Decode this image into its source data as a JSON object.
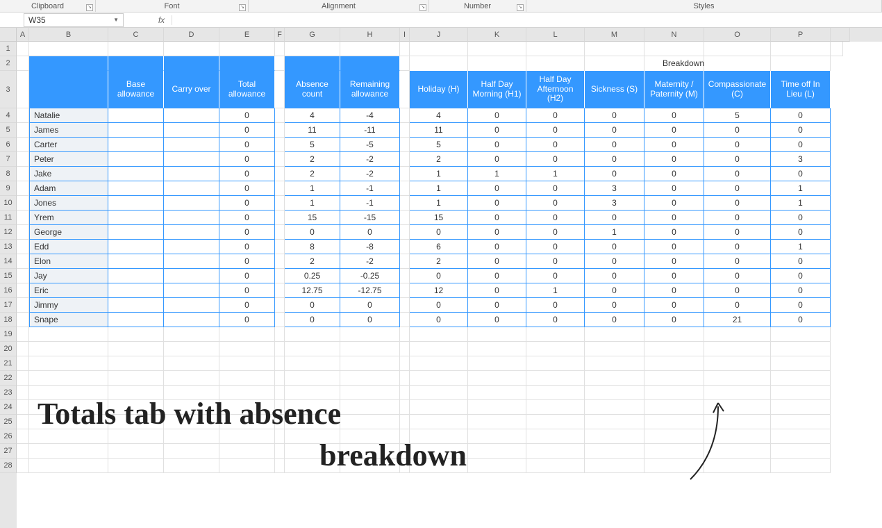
{
  "ribbon": {
    "groups": [
      "Clipboard",
      "Font",
      "Alignment",
      "Number",
      "Styles"
    ]
  },
  "cell_ref": "W35",
  "fx_label": "fx",
  "formula_value": "",
  "columns": [
    "A",
    "B",
    "C",
    "D",
    "E",
    "F",
    "G",
    "H",
    "I",
    "J",
    "K",
    "L",
    "M",
    "N",
    "O",
    "P"
  ],
  "row_numbers": [
    1,
    2,
    3,
    4,
    5,
    6,
    7,
    8,
    9,
    10,
    11,
    12,
    13,
    14,
    15,
    16,
    17,
    18,
    19,
    20,
    21,
    22,
    23,
    24,
    25,
    26,
    27,
    28
  ],
  "breakdown_title": "Breakdown",
  "headers": {
    "name": "",
    "base": "Base allowance",
    "carry": "Carry over",
    "total": "Total allowance",
    "abs": "Absence count",
    "rem": "Remaining allowance",
    "j": "Holiday (H)",
    "k": "Half Day Morning (H1)",
    "l": "Half Day Afternoon (H2)",
    "m": "Sickness (S)",
    "n": "Maternity / Paternity (M)",
    "o": "Compassionate (C)",
    "p": "Time off In Lieu (L)"
  },
  "rows": [
    {
      "name": "Natalie",
      "total": "0",
      "abs": "4",
      "rem": "-4",
      "j": "4",
      "k": "0",
      "l": "0",
      "m": "0",
      "n": "0",
      "o": "5",
      "p": "0"
    },
    {
      "name": "James",
      "total": "0",
      "abs": "11",
      "rem": "-11",
      "j": "11",
      "k": "0",
      "l": "0",
      "m": "0",
      "n": "0",
      "o": "0",
      "p": "0"
    },
    {
      "name": "Carter",
      "total": "0",
      "abs": "5",
      "rem": "-5",
      "j": "5",
      "k": "0",
      "l": "0",
      "m": "0",
      "n": "0",
      "o": "0",
      "p": "0"
    },
    {
      "name": "Peter",
      "total": "0",
      "abs": "2",
      "rem": "-2",
      "j": "2",
      "k": "0",
      "l": "0",
      "m": "0",
      "n": "0",
      "o": "0",
      "p": "3"
    },
    {
      "name": "Jake",
      "total": "0",
      "abs": "2",
      "rem": "-2",
      "j": "1",
      "k": "1",
      "l": "1",
      "m": "0",
      "n": "0",
      "o": "0",
      "p": "0"
    },
    {
      "name": "Adam",
      "total": "0",
      "abs": "1",
      "rem": "-1",
      "j": "1",
      "k": "0",
      "l": "0",
      "m": "3",
      "n": "0",
      "o": "0",
      "p": "1"
    },
    {
      "name": "Jones",
      "total": "0",
      "abs": "1",
      "rem": "-1",
      "j": "1",
      "k": "0",
      "l": "0",
      "m": "3",
      "n": "0",
      "o": "0",
      "p": "1"
    },
    {
      "name": "Yrem",
      "total": "0",
      "abs": "15",
      "rem": "-15",
      "j": "15",
      "k": "0",
      "l": "0",
      "m": "0",
      "n": "0",
      "o": "0",
      "p": "0"
    },
    {
      "name": "George",
      "total": "0",
      "abs": "0",
      "rem": "0",
      "j": "0",
      "k": "0",
      "l": "0",
      "m": "1",
      "n": "0",
      "o": "0",
      "p": "0"
    },
    {
      "name": "Edd",
      "total": "0",
      "abs": "8",
      "rem": "-8",
      "j": "6",
      "k": "0",
      "l": "0",
      "m": "0",
      "n": "0",
      "o": "0",
      "p": "1"
    },
    {
      "name": "Elon",
      "total": "0",
      "abs": "2",
      "rem": "-2",
      "j": "2",
      "k": "0",
      "l": "0",
      "m": "0",
      "n": "0",
      "o": "0",
      "p": "0"
    },
    {
      "name": "Jay",
      "total": "0",
      "abs": "0.25",
      "rem": "-0.25",
      "j": "0",
      "k": "0",
      "l": "0",
      "m": "0",
      "n": "0",
      "o": "0",
      "p": "0"
    },
    {
      "name": "Eric",
      "total": "0",
      "abs": "12.75",
      "rem": "-12.75",
      "j": "12",
      "k": "0",
      "l": "1",
      "m": "0",
      "n": "0",
      "o": "0",
      "p": "0"
    },
    {
      "name": "Jimmy",
      "total": "0",
      "abs": "0",
      "rem": "0",
      "j": "0",
      "k": "0",
      "l": "0",
      "m": "0",
      "n": "0",
      "o": "0",
      "p": "0"
    },
    {
      "name": "Snape",
      "total": "0",
      "abs": "0",
      "rem": "0",
      "j": "0",
      "k": "0",
      "l": "0",
      "m": "0",
      "n": "0",
      "o": "21",
      "p": "0"
    }
  ],
  "annotation_line1": "Totals tab with absence",
  "annotation_line2": "breakdown",
  "chart_data": {
    "type": "table",
    "title": "Absence breakdown",
    "columns": [
      "Name",
      "Base allowance",
      "Carry over",
      "Total allowance",
      "Absence count",
      "Remaining allowance",
      "Holiday (H)",
      "Half Day Morning (H1)",
      "Half Day Afternoon (H2)",
      "Sickness (S)",
      "Maternity / Paternity (M)",
      "Compassionate (C)",
      "Time off In Lieu (L)"
    ],
    "rows": [
      [
        "Natalie",
        "",
        "",
        0,
        4,
        -4,
        4,
        0,
        0,
        0,
        0,
        5,
        0
      ],
      [
        "James",
        "",
        "",
        0,
        11,
        -11,
        11,
        0,
        0,
        0,
        0,
        0,
        0
      ],
      [
        "Carter",
        "",
        "",
        0,
        5,
        -5,
        5,
        0,
        0,
        0,
        0,
        0,
        0
      ],
      [
        "Peter",
        "",
        "",
        0,
        2,
        -2,
        2,
        0,
        0,
        0,
        0,
        0,
        3
      ],
      [
        "Jake",
        "",
        "",
        0,
        2,
        -2,
        1,
        1,
        1,
        0,
        0,
        0,
        0
      ],
      [
        "Adam",
        "",
        "",
        0,
        1,
        -1,
        1,
        0,
        0,
        3,
        0,
        0,
        1
      ],
      [
        "Jones",
        "",
        "",
        0,
        1,
        -1,
        1,
        0,
        0,
        3,
        0,
        0,
        1
      ],
      [
        "Yrem",
        "",
        "",
        0,
        15,
        -15,
        15,
        0,
        0,
        0,
        0,
        0,
        0
      ],
      [
        "George",
        "",
        "",
        0,
        0,
        0,
        0,
        0,
        0,
        1,
        0,
        0,
        0
      ],
      [
        "Edd",
        "",
        "",
        0,
        8,
        -8,
        6,
        0,
        0,
        0,
        0,
        0,
        1
      ],
      [
        "Elon",
        "",
        "",
        0,
        2,
        -2,
        2,
        0,
        0,
        0,
        0,
        0,
        0
      ],
      [
        "Jay",
        "",
        "",
        0,
        0.25,
        -0.25,
        0,
        0,
        0,
        0,
        0,
        0,
        0
      ],
      [
        "Eric",
        "",
        "",
        0,
        12.75,
        -12.75,
        12,
        0,
        1,
        0,
        0,
        0,
        0
      ],
      [
        "Jimmy",
        "",
        "",
        0,
        0,
        0,
        0,
        0,
        0,
        0,
        0,
        0,
        0
      ],
      [
        "Snape",
        "",
        "",
        0,
        0,
        0,
        0,
        0,
        0,
        0,
        0,
        21,
        0
      ]
    ]
  }
}
